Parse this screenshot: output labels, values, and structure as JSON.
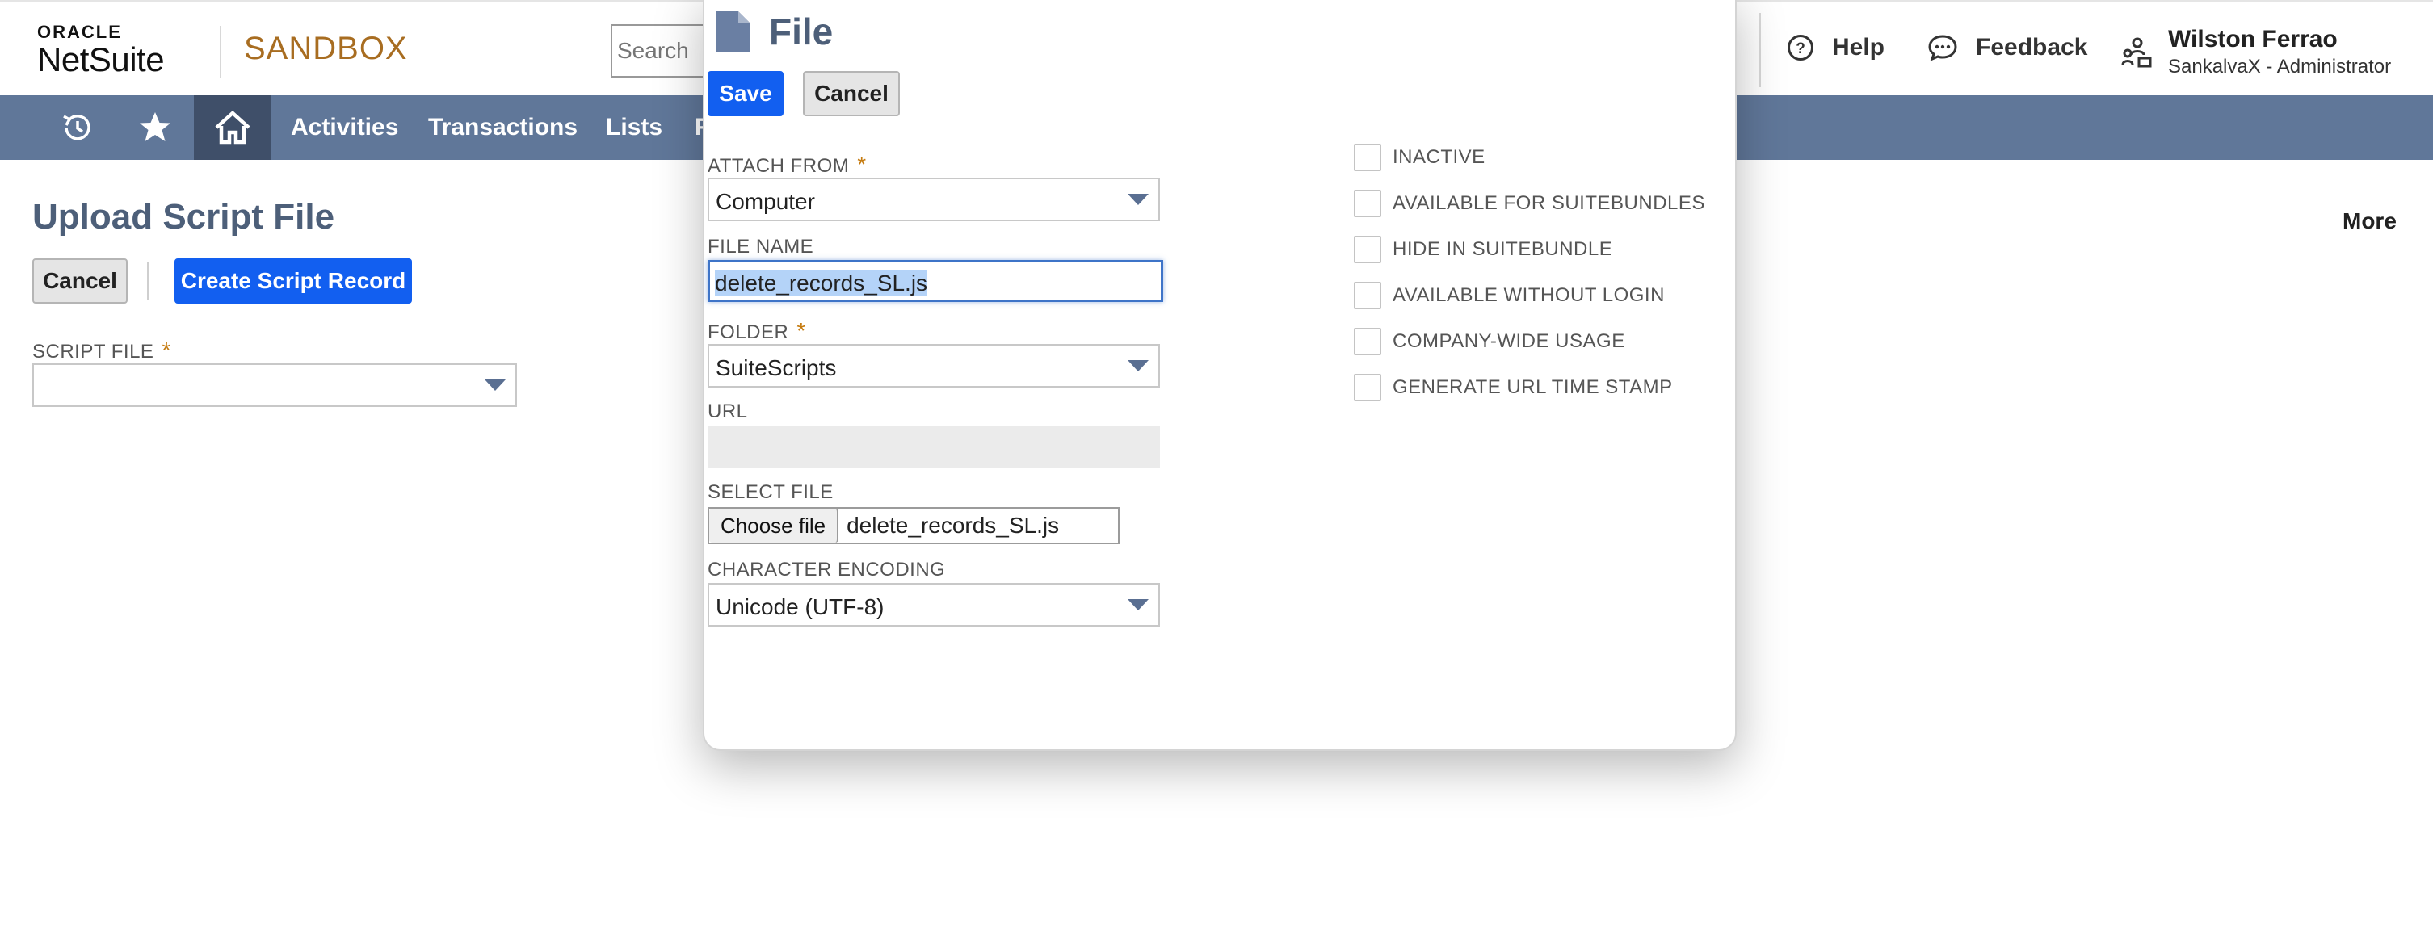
{
  "header": {
    "logo_top": "ORACLE",
    "logo_main": "NetSuite",
    "environment": "SANDBOX",
    "search_placeholder": "Search",
    "help_label": "Help",
    "feedback_label": "Feedback",
    "user_name": "Wilston Ferrao",
    "user_role": "SankalvaX - Administrator"
  },
  "nav": {
    "items": [
      "Activities",
      "Transactions",
      "Lists",
      "F"
    ]
  },
  "page": {
    "title": "Upload Script File",
    "cancel_label": "Cancel",
    "create_label": "Create Script Record",
    "more_label": "More",
    "script_file_label": "SCRIPT FILE",
    "script_file_value": "",
    "required_mark": "*"
  },
  "dialog": {
    "title": "File",
    "save_label": "Save",
    "cancel_label": "Cancel",
    "attach_from": {
      "label": "ATTACH FROM",
      "value": "Computer"
    },
    "file_name": {
      "label": "FILE NAME",
      "value": "delete_records_SL.js"
    },
    "folder": {
      "label": "FOLDER",
      "value": "SuiteScripts"
    },
    "url": {
      "label": "URL",
      "value": ""
    },
    "select_file": {
      "label": "SELECT FILE",
      "button_label": "Choose file",
      "chosen": "delete_records_SL.js"
    },
    "encoding": {
      "label": "CHARACTER ENCODING",
      "value": "Unicode (UTF-8)"
    },
    "checkboxes": [
      {
        "label": "INACTIVE",
        "checked": false
      },
      {
        "label": "AVAILABLE FOR SUITEBUNDLES",
        "checked": false
      },
      {
        "label": "HIDE IN SUITEBUNDLE",
        "checked": false
      },
      {
        "label": "AVAILABLE WITHOUT LOGIN",
        "checked": false
      },
      {
        "label": "COMPANY-WIDE USAGE",
        "checked": false
      },
      {
        "label": "GENERATE URL TIME STAMP",
        "checked": false
      }
    ]
  },
  "colors": {
    "navbar": "#607799",
    "nav_active": "#3f4f69",
    "primary_button": "#125ff0",
    "title": "#4d5f79",
    "sandbox": "#a86d21",
    "required": "#c57b10"
  }
}
